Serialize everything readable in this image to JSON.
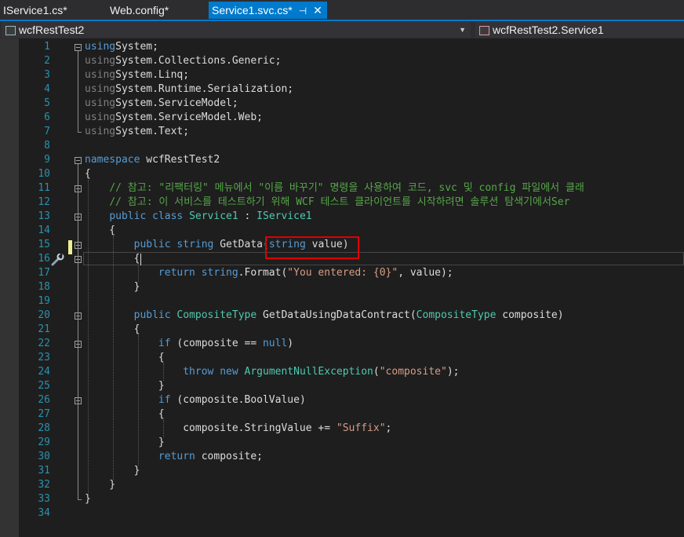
{
  "tabs": [
    {
      "label": "IService1.cs*"
    },
    {
      "label": "Web.config*"
    },
    {
      "label": "Service1.svc.cs*",
      "pin": "⊣",
      "close": "✕"
    }
  ],
  "nav": {
    "project": "wcfRestTest2",
    "member": "wcfRestTest2.Service1"
  },
  "colors": {
    "accent": "#007acc",
    "keyword": "#569cd6",
    "type": "#4ec9b0",
    "string": "#d69d85",
    "comment": "#57a64a",
    "line_number": "#2b91af",
    "highlight_box": "#e00000"
  },
  "icons": [
    "project-icon",
    "class-icon",
    "dropdown-arrow-icon",
    "pin-icon",
    "close-icon",
    "quick-actions-wrench-icon",
    "collapse-icon"
  ],
  "lines": [
    {
      "n": "1",
      "t": [
        [
          "kw",
          "using"
        ],
        [
          "",
          "System;"
        ]
      ]
    },
    {
      "n": "2",
      "t": [
        [
          "kw",
          "using"
        ],
        [
          "",
          "System.Collections.Generic;"
        ]
      ]
    },
    {
      "n": "3",
      "t": [
        [
          "kw",
          "using"
        ],
        [
          "",
          "System.Linq;"
        ]
      ]
    },
    {
      "n": "4",
      "t": [
        [
          "kw",
          "using"
        ],
        [
          "",
          "System.Runtime.Serialization;"
        ]
      ]
    },
    {
      "n": "5",
      "t": [
        [
          "kw",
          "using"
        ],
        [
          "",
          "System.ServiceModel;"
        ]
      ]
    },
    {
      "n": "6",
      "t": [
        [
          "kw",
          "using"
        ],
        [
          "",
          "System.ServiceModel.Web;"
        ]
      ]
    },
    {
      "n": "7",
      "t": [
        [
          "kw",
          "using"
        ],
        [
          "",
          "System.Text;"
        ]
      ]
    },
    {
      "n": "8",
      "t": []
    },
    {
      "n": "9",
      "t": [
        [
          "kw",
          "namespace"
        ],
        [
          "",
          " wcfRestTest2"
        ]
      ]
    },
    {
      "n": "10",
      "t": [
        [
          "",
          "{"
        ]
      ]
    },
    {
      "n": "11",
      "t": [
        [
          "",
          "    "
        ],
        [
          "cm",
          "// 참고: \"리팩터링\" 메뉴에서 \"이름 바꾸기\" 명령을 사용하여 코드, svc 및 config 파일에서 클래"
        ]
      ]
    },
    {
      "n": "12",
      "t": [
        [
          "",
          "    "
        ],
        [
          "cm",
          "// 참고: 이 서비스를 테스트하기 위해 WCF 테스트 클라이언트를 시작하려면 솔루션 탐색기에서Ser"
        ]
      ]
    },
    {
      "n": "13",
      "t": [
        [
          "",
          "    "
        ],
        [
          "kw",
          "public class"
        ],
        [
          "",
          " "
        ],
        [
          "ty",
          "Service1"
        ],
        [
          "",
          " : "
        ],
        [
          "ty",
          "IService1"
        ]
      ]
    },
    {
      "n": "14",
      "t": [
        [
          "",
          "    {"
        ]
      ]
    },
    {
      "n": "15",
      "t": [
        [
          "",
          "        "
        ],
        [
          "kw",
          "public string"
        ],
        [
          "",
          " GetData("
        ],
        [
          "kw",
          "string"
        ],
        [
          "",
          " value)"
        ]
      ]
    },
    {
      "n": "16",
      "t": [
        [
          "",
          "        {"
        ]
      ]
    },
    {
      "n": "17",
      "t": [
        [
          "",
          "            "
        ],
        [
          "kw",
          "return string"
        ],
        [
          "",
          ".Format("
        ],
        [
          "st",
          "\"You entered: {0}\""
        ],
        [
          "",
          ", value);"
        ]
      ]
    },
    {
      "n": "18",
      "t": [
        [
          "",
          "        }"
        ]
      ]
    },
    {
      "n": "19",
      "t": []
    },
    {
      "n": "20",
      "t": [
        [
          "",
          "        "
        ],
        [
          "kw",
          "public"
        ],
        [
          "",
          " "
        ],
        [
          "ty",
          "CompositeType"
        ],
        [
          "",
          " GetDataUsingDataContract("
        ],
        [
          "ty",
          "CompositeType"
        ],
        [
          "",
          " composite)"
        ]
      ]
    },
    {
      "n": "21",
      "t": [
        [
          "",
          "        {"
        ]
      ]
    },
    {
      "n": "22",
      "t": [
        [
          "",
          "            "
        ],
        [
          "kw",
          "if"
        ],
        [
          "",
          " (composite == "
        ],
        [
          "kw",
          "null"
        ],
        [
          "",
          ")"
        ]
      ]
    },
    {
      "n": "23",
      "t": [
        [
          "",
          "            {"
        ]
      ]
    },
    {
      "n": "24",
      "t": [
        [
          "",
          "                "
        ],
        [
          "kw",
          "throw new"
        ],
        [
          "",
          " "
        ],
        [
          "ty",
          "ArgumentNullException"
        ],
        [
          "",
          "("
        ],
        [
          "st",
          "\"composite\""
        ],
        [
          "",
          ");"
        ]
      ]
    },
    {
      "n": "25",
      "t": [
        [
          "",
          "            }"
        ]
      ]
    },
    {
      "n": "26",
      "t": [
        [
          "",
          "            "
        ],
        [
          "kw",
          "if"
        ],
        [
          "",
          " (composite.BoolValue)"
        ]
      ]
    },
    {
      "n": "27",
      "t": [
        [
          "",
          "            {"
        ]
      ]
    },
    {
      "n": "28",
      "t": [
        [
          "",
          "                composite.StringValue += "
        ],
        [
          "st",
          "\"Suffix\""
        ],
        [
          "",
          ";"
        ]
      ]
    },
    {
      "n": "29",
      "t": [
        [
          "",
          "            }"
        ]
      ]
    },
    {
      "n": "30",
      "t": [
        [
          "",
          "            "
        ],
        [
          "kw",
          "return"
        ],
        [
          "",
          " composite;"
        ]
      ]
    },
    {
      "n": "31",
      "t": [
        [
          "",
          "        }"
        ]
      ]
    },
    {
      "n": "32",
      "t": [
        [
          "",
          "    }"
        ]
      ]
    },
    {
      "n": "33",
      "t": [
        [
          "",
          "}"
        ]
      ]
    },
    {
      "n": "34",
      "t": []
    }
  ]
}
